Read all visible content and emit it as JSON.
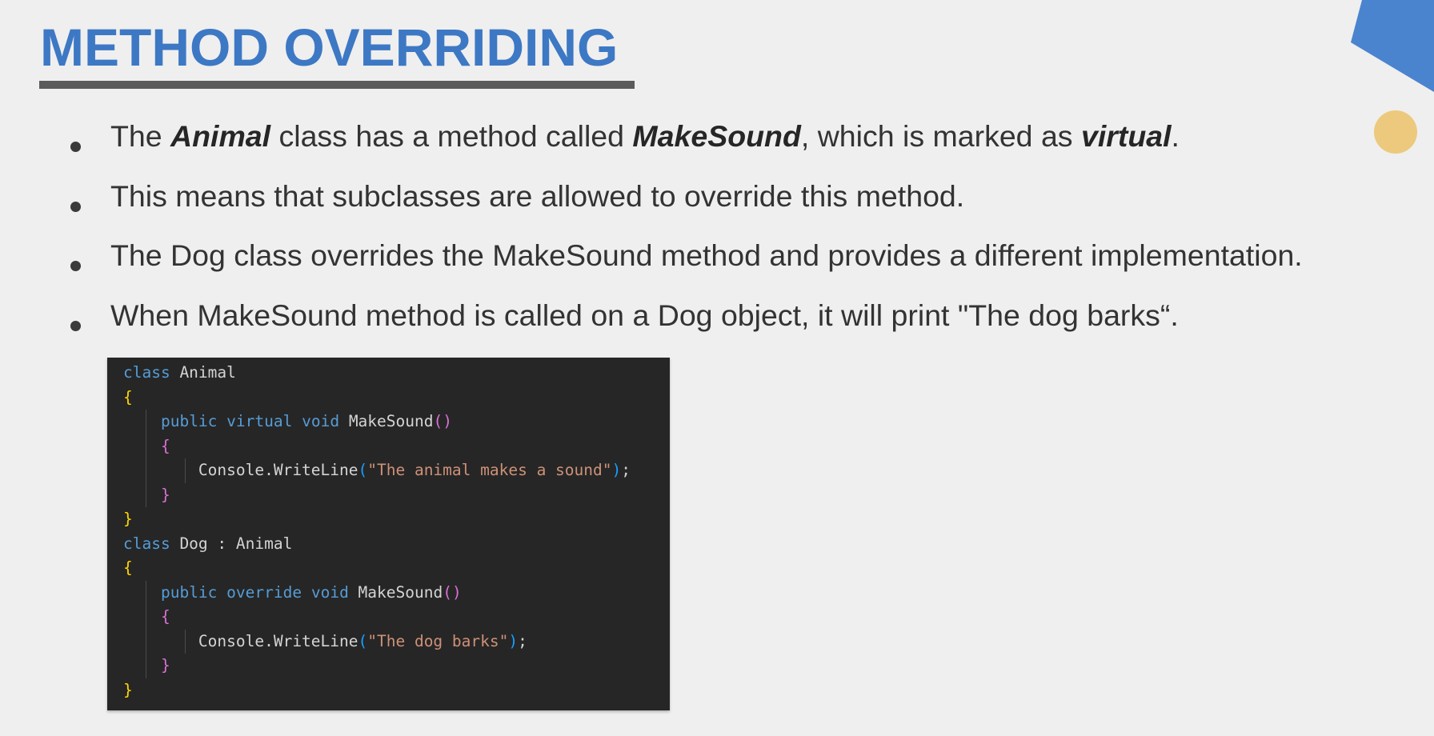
{
  "slide": {
    "title": "METHOD OVERRIDING",
    "accent_color": "#3d78c4",
    "decor_color": "#ecc97c"
  },
  "bullets": [
    {
      "segments": [
        {
          "text": "The ",
          "emph": false
        },
        {
          "text": "Animal",
          "emph": true
        },
        {
          "text": " class has a method called ",
          "emph": false
        },
        {
          "text": "MakeSound",
          "emph": true
        },
        {
          "text": ", which is marked as ",
          "emph": false
        },
        {
          "text": "virtual",
          "emph": true
        },
        {
          "text": ".",
          "emph": false
        }
      ]
    },
    {
      "segments": [
        {
          "text": "This means that subclasses are allowed to override this method.",
          "emph": false
        }
      ]
    },
    {
      "segments": [
        {
          "text": "The Dog class overrides the MakeSound method and provides a different implementation.",
          "emph": false
        }
      ]
    },
    {
      "segments": [
        {
          "text": "When MakeSound method is called on a Dog object, it will print \"The dog barks“.",
          "emph": false
        }
      ]
    }
  ],
  "code": {
    "lines": [
      [
        {
          "t": "class",
          "c": "kw"
        },
        {
          "t": " Animal",
          "c": ""
        }
      ],
      [
        {
          "t": "{",
          "c": "br1"
        }
      ],
      [
        {
          "t": "    ",
          "c": ""
        },
        {
          "t": "public",
          "c": "kw"
        },
        {
          "t": " ",
          "c": ""
        },
        {
          "t": "virtual",
          "c": "kw"
        },
        {
          "t": " ",
          "c": ""
        },
        {
          "t": "void",
          "c": "kw"
        },
        {
          "t": " MakeSound",
          "c": ""
        },
        {
          "t": "()",
          "c": "br2"
        }
      ],
      [
        {
          "t": "    ",
          "c": ""
        },
        {
          "t": "{",
          "c": "br2"
        }
      ],
      [
        {
          "t": "        Console.WriteLine",
          "c": ""
        },
        {
          "t": "(",
          "c": "br3"
        },
        {
          "t": "\"The animal makes a sound\"",
          "c": "str"
        },
        {
          "t": ")",
          "c": "br3"
        },
        {
          "t": ";",
          "c": ""
        }
      ],
      [
        {
          "t": "    ",
          "c": ""
        },
        {
          "t": "}",
          "c": "br2"
        }
      ],
      [
        {
          "t": "}",
          "c": "br1"
        }
      ],
      [
        {
          "t": "class",
          "c": "kw"
        },
        {
          "t": " Dog : Animal",
          "c": ""
        }
      ],
      [
        {
          "t": "{",
          "c": "br1"
        }
      ],
      [
        {
          "t": "    ",
          "c": ""
        },
        {
          "t": "public",
          "c": "kw"
        },
        {
          "t": " ",
          "c": ""
        },
        {
          "t": "override",
          "c": "kw"
        },
        {
          "t": " ",
          "c": ""
        },
        {
          "t": "void",
          "c": "kw"
        },
        {
          "t": " MakeSound",
          "c": ""
        },
        {
          "t": "()",
          "c": "br2"
        }
      ],
      [
        {
          "t": "    ",
          "c": ""
        },
        {
          "t": "{",
          "c": "br2"
        }
      ],
      [
        {
          "t": "        Console.WriteLine",
          "c": ""
        },
        {
          "t": "(",
          "c": "br3"
        },
        {
          "t": "\"The dog barks\"",
          "c": "str"
        },
        {
          "t": ")",
          "c": "br3"
        },
        {
          "t": ";",
          "c": ""
        }
      ],
      [
        {
          "t": "    ",
          "c": ""
        },
        {
          "t": "}",
          "c": "br2"
        }
      ],
      [
        {
          "t": "}",
          "c": "br1"
        }
      ]
    ]
  }
}
